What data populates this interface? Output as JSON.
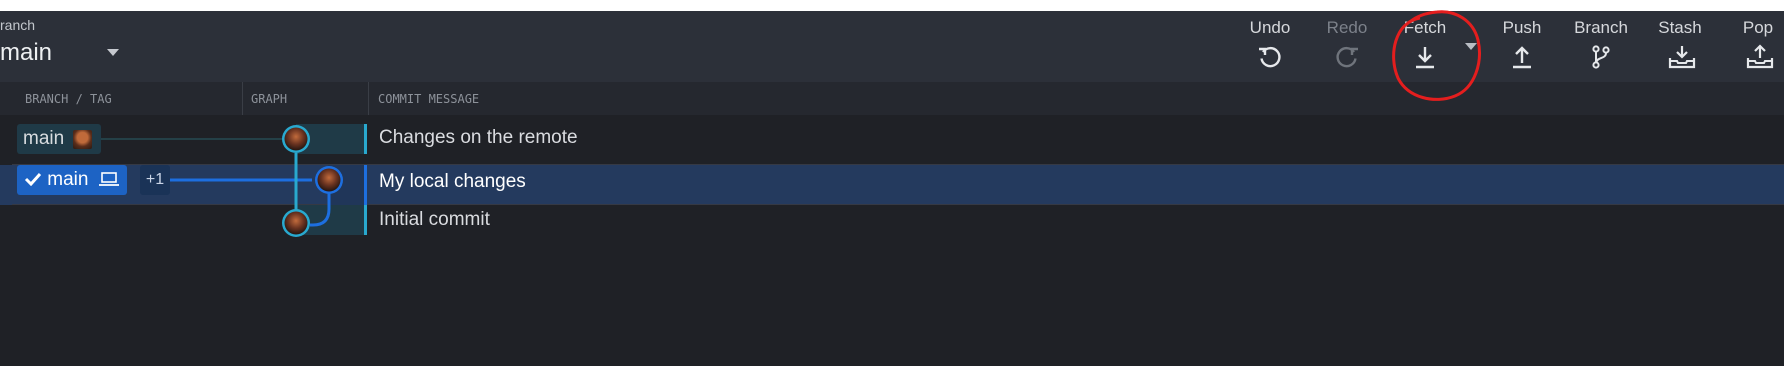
{
  "toolbar": {
    "branch_caption": "ranch",
    "branch_name": "main",
    "buttons": [
      {
        "label": "Undo",
        "icon": "undo-icon",
        "enabled": true
      },
      {
        "label": "Redo",
        "icon": "redo-icon",
        "enabled": false
      },
      {
        "label": "Fetch",
        "icon": "fetch-icon",
        "enabled": true
      },
      {
        "label": "Push",
        "icon": "push-icon",
        "enabled": true
      },
      {
        "label": "Branch",
        "icon": "branch-icon",
        "enabled": true
      },
      {
        "label": "Stash",
        "icon": "stash-icon",
        "enabled": true
      },
      {
        "label": "Pop",
        "icon": "pop-icon",
        "enabled": true
      }
    ]
  },
  "columns": {
    "branch_tag": "BRANCH / TAG",
    "graph": "GRAPH",
    "commit_message": "COMMIT MESSAGE"
  },
  "commits": [
    {
      "message": "Changes on the remote",
      "branch_label": "main",
      "location": "remote",
      "selected": false
    },
    {
      "message": "My local changes",
      "branch_label": "main",
      "location": "local",
      "checked_out": true,
      "extra_refs": "+1",
      "selected": true
    },
    {
      "message": "Initial commit",
      "selected": false
    }
  ],
  "colors": {
    "accent_blue": "#1d63c4",
    "graph_teal": "#29a9cf",
    "annotation_red": "#e41e1e"
  }
}
